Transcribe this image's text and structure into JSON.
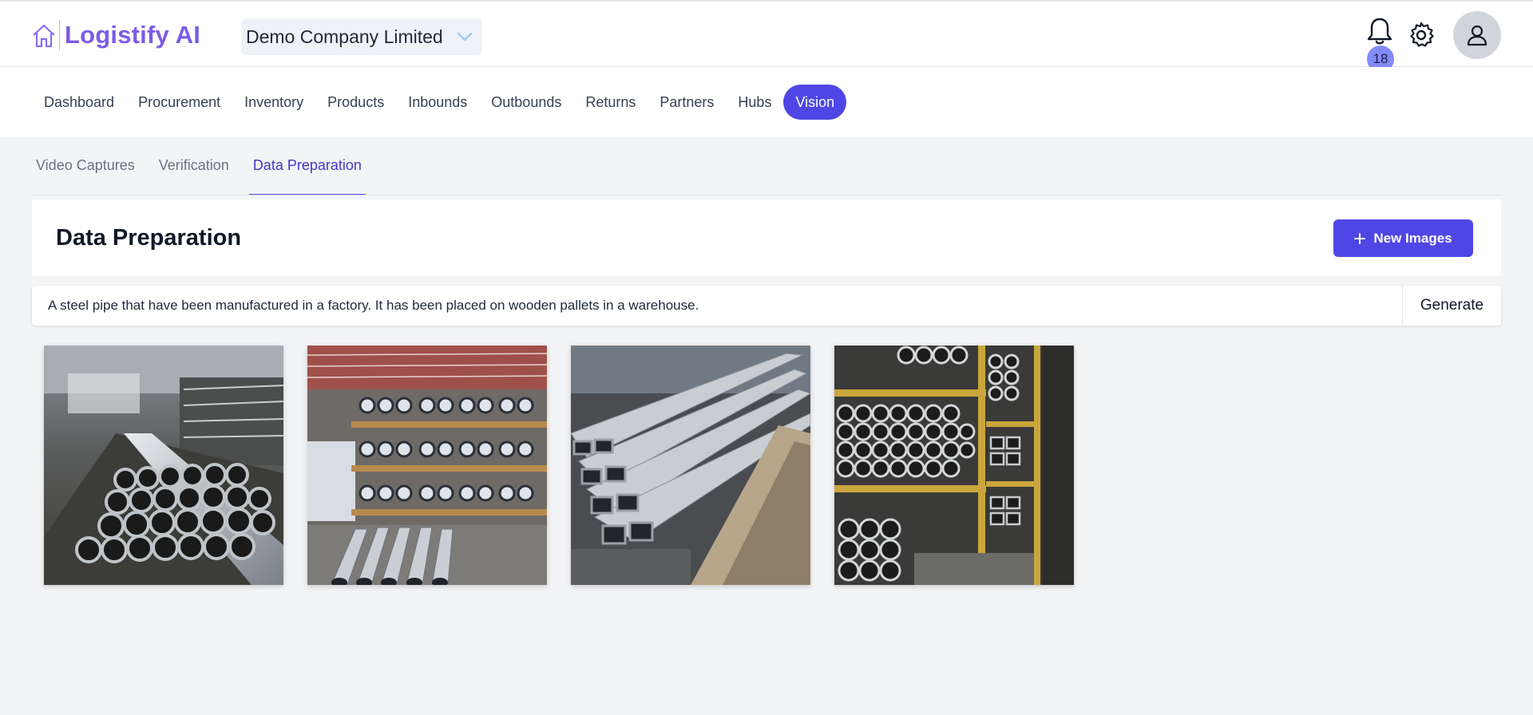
{
  "app": {
    "name": "Logistify AI",
    "brand_color": "#7c5ce6",
    "accent_color": "#4f46e5"
  },
  "header": {
    "company": "Demo Company Limited",
    "notification_count": "18",
    "icons": [
      "home-icon",
      "chevron-down-icon",
      "bell-icon",
      "gear-icon",
      "user-icon"
    ]
  },
  "nav": {
    "items": [
      "Dashboard",
      "Procurement",
      "Inventory",
      "Products",
      "Inbounds",
      "Outbounds",
      "Returns",
      "Partners",
      "Hubs",
      "Vision"
    ],
    "active": "Vision"
  },
  "subtabs": {
    "items": [
      "Video Captures",
      "Verification",
      "Data Preparation"
    ],
    "active": "Data Preparation"
  },
  "page": {
    "title": "Data Preparation",
    "new_images_label": "New Images",
    "prompt_value": "A steel pipe that have been manufactured in a factory. It has been placed on wooden pallets in a warehouse.",
    "generate_label": "Generate"
  },
  "gallery": {
    "images": [
      "steel-pipes-factory-floor",
      "pipes-on-pallet-racks",
      "rectangular-steel-tubes-stack",
      "pipes-on-yellow-racks"
    ]
  }
}
